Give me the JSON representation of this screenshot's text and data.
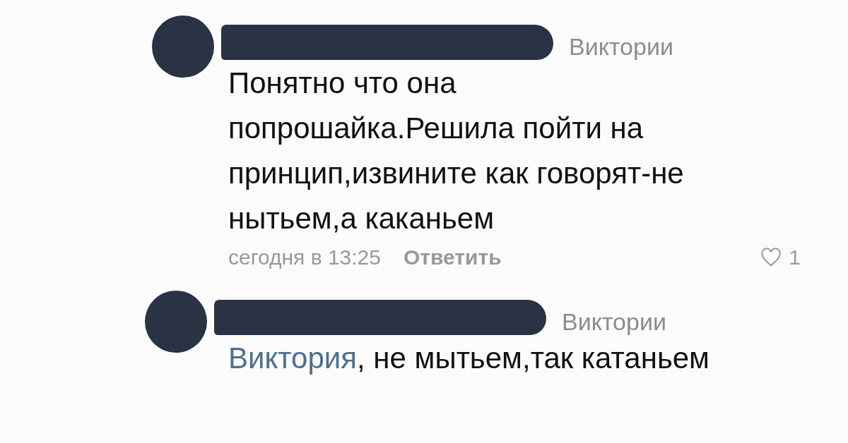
{
  "comments": [
    {
      "reply_to": "Виктории",
      "text": "Понятно что она попрошайка.Решила пойти на принцип,извините как говорят-не нытьем,а каканьем",
      "time": "сегодня в 13:25",
      "reply_label": "Ответить",
      "likes": "1",
      "liked": false
    },
    {
      "reply_to": "Виктории",
      "mention": "Виктория",
      "text": ", не мытьем,так катаньем"
    }
  ]
}
